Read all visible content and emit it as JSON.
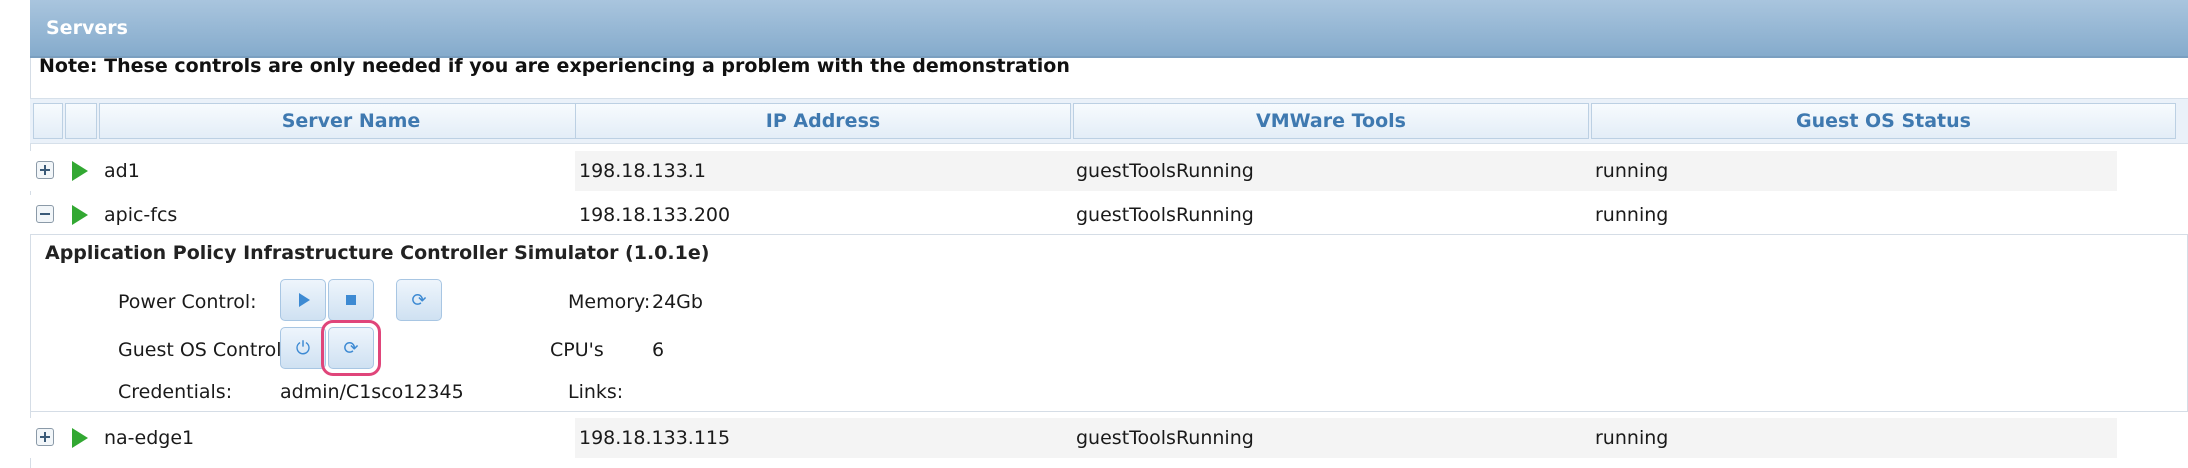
{
  "panel": {
    "title": "Servers",
    "note": "Note: These controls are only needed if you are experiencing a problem with the demonstration"
  },
  "table": {
    "columns": [
      "Server Name",
      "IP Address",
      "VMWare Tools",
      "Guest OS Status"
    ],
    "rows": [
      {
        "name": "ad1",
        "ip": "198.18.133.1",
        "tools": "guestToolsRunning",
        "status": "running",
        "expanded": false
      },
      {
        "name": "apic-fcs",
        "ip": "198.18.133.200",
        "tools": "guestToolsRunning",
        "status": "running",
        "expanded": true
      },
      {
        "name": "na-edge1",
        "ip": "198.18.133.115",
        "tools": "guestToolsRunning",
        "status": "running",
        "expanded": false
      }
    ]
  },
  "detail": {
    "title": "Application Policy Infrastructure Controller Simulator (1.0.1e)",
    "power_control_label": "Power Control:",
    "guest_os_control_label": "Guest OS Control:",
    "credentials_label": "Credentials:",
    "credentials_value": "admin/C1sco12345",
    "memory_label": "Memory:",
    "memory_value": "24Gb",
    "cpus_label": "CPU's",
    "cpus_value": "6",
    "links_label": "Links:"
  },
  "icons": {
    "power_on": "play-icon",
    "power_off": "stop-icon",
    "power_reset": "refresh-icon",
    "guest_shutdown": "power-icon",
    "guest_restart": "refresh-icon"
  },
  "colors": {
    "header_text": "#3f79b0",
    "play_green": "#32a832",
    "button_icon": "#3d8ad3",
    "selection_outline": "#e0457a",
    "title_bar": "#95b7d5"
  }
}
